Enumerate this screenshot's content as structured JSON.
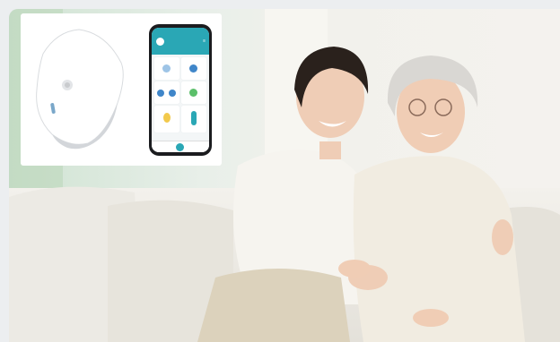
{
  "image": {
    "subjects": [
      "woman-younger",
      "woman-elder"
    ],
    "accent_color": "#2aa7b5",
    "device_color": "#ffffff"
  }
}
